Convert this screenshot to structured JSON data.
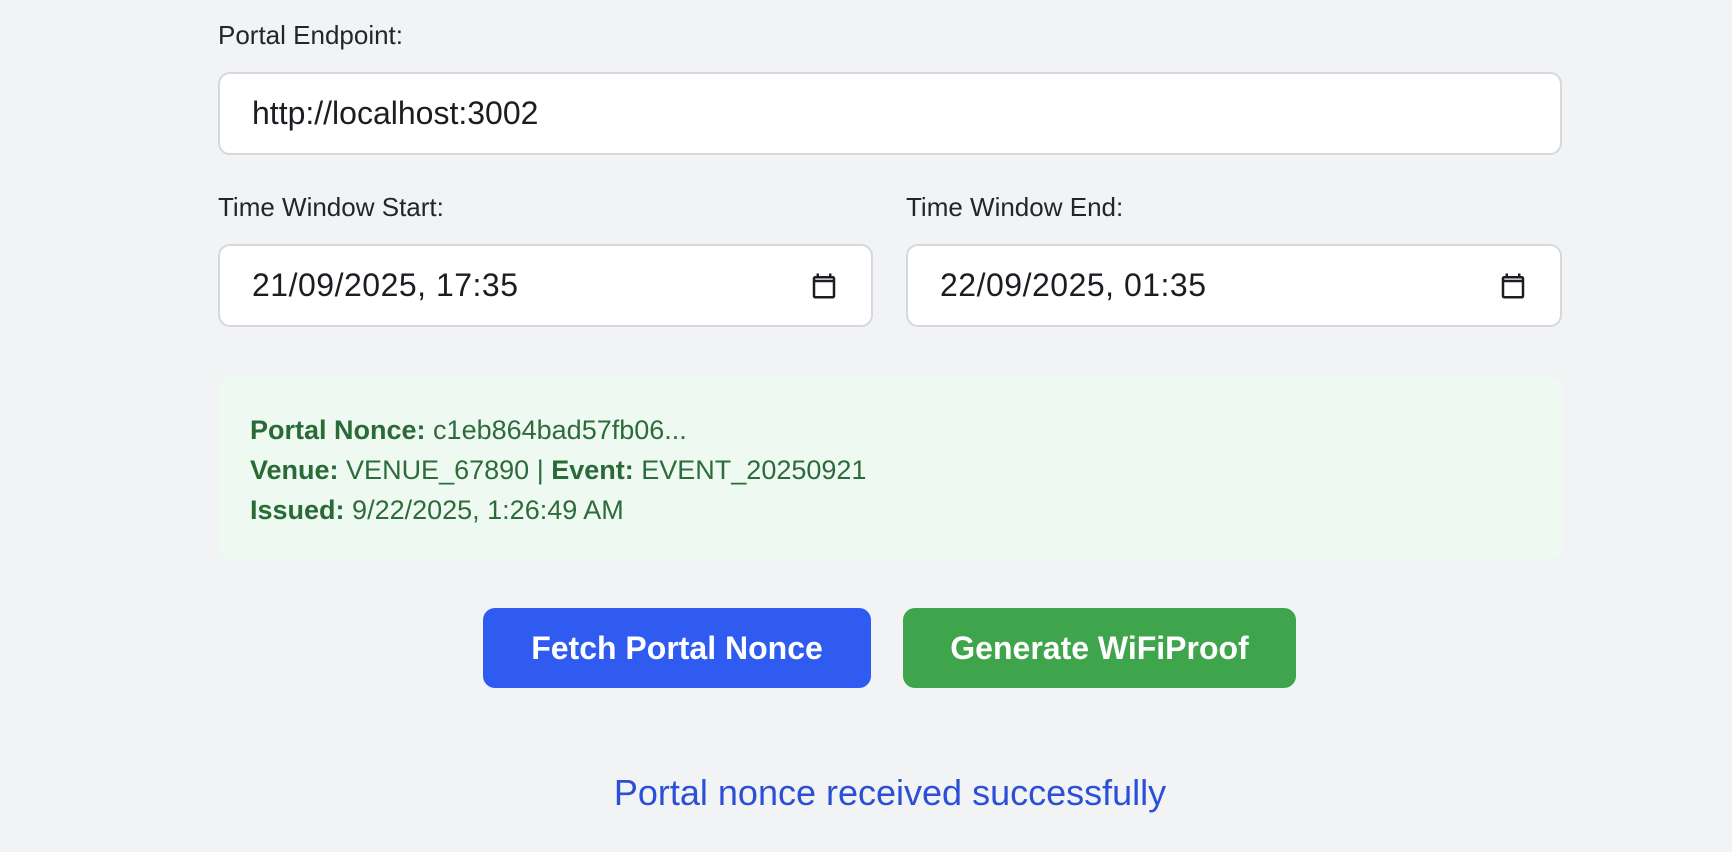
{
  "endpoint": {
    "label": "Portal Endpoint:",
    "value": "http://localhost:3002"
  },
  "time_window": {
    "start_label": "Time Window Start:",
    "start_value": "21/09/2025, 17:35",
    "end_label": "Time Window End:",
    "end_value": "22/09/2025, 01:35",
    "icon": "calendar-icon"
  },
  "nonce_info": {
    "nonce_label": "Portal Nonce:",
    "nonce_value": "c1eb864bad57fb06...",
    "venue_label": "Venue:",
    "venue_value": "VENUE_67890",
    "separator": "|",
    "event_label": "Event:",
    "event_value": "EVENT_20250921",
    "issued_label": "Issued:",
    "issued_value": "9/22/2025, 1:26:49 AM"
  },
  "buttons": {
    "fetch_label": "Fetch Portal Nonce",
    "generate_label": "Generate WiFiProof"
  },
  "status": {
    "message": "Portal nonce received successfully"
  },
  "colors": {
    "background": "#f2f3f5",
    "fetch_button": "#2f5bf0",
    "generate_button": "#3ea54c",
    "nonce_box_bg": "#eefaf1",
    "nonce_text": "#2e6b3b",
    "status_text": "#2b4fd6"
  }
}
